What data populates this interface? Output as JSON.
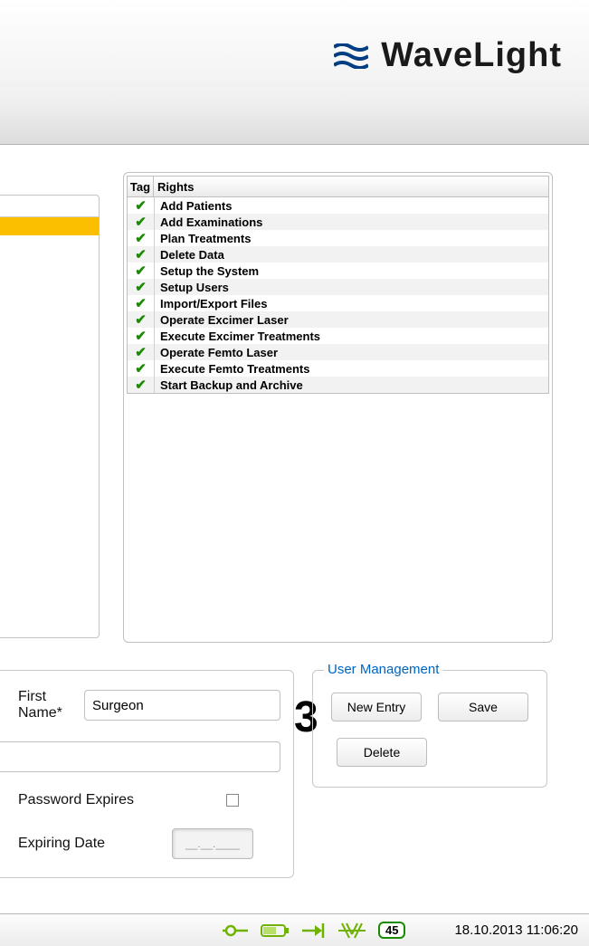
{
  "logo_text": "WaveLight",
  "rights_table": {
    "header_tag": "Tag",
    "header_rights": "Rights",
    "rows": [
      "Add Patients",
      "Add Examinations",
      "Plan Treatments",
      "Delete Data",
      "Setup the System",
      "Setup Users",
      "Import/Export Files",
      "Operate Excimer Laser",
      "Execute Excimer Treatments",
      "Operate Femto Laser",
      "Execute Femto Treatments",
      "Start Backup and Archive"
    ]
  },
  "form": {
    "first_name_label": "First Name*",
    "first_name_value": "Surgeon",
    "password_expires_label": "Password Expires",
    "password_expires_checked": false,
    "expiring_date_label": "Expiring Date",
    "expiring_date_value": "__.__.____"
  },
  "callout_3": "3",
  "user_mgmt": {
    "title": "User Management",
    "new_entry": "New Entry",
    "save": "Save",
    "delete": "Delete"
  },
  "statusbar": {
    "badge": "45",
    "datetime": "18.10.2013 11:06:20"
  }
}
